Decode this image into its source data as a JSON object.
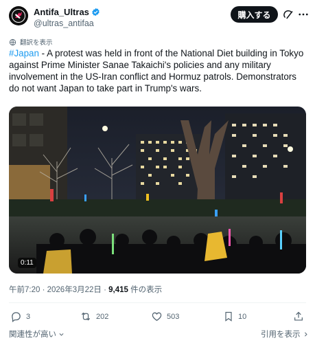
{
  "author": {
    "name": "Antifa_Ultras",
    "handle": "@ultras_antifaa",
    "verified": true
  },
  "header": {
    "buy_label": "購入する"
  },
  "translate": {
    "label": "翻訳を表示"
  },
  "post": {
    "hashtag": "#Japan",
    "text": " - A protest was held in front of the National Diet building in Tokyo against Prime Minister Sanae Takaichi's policies and any military involvement in the US-Iran conflict and Hormuz patrols. Demonstrators do not want Japan to take part in Trump's wars."
  },
  "media": {
    "duration": "0:11"
  },
  "meta": {
    "time": "午前7:20",
    "sep": " · ",
    "date": "2026年3月22日",
    "views": "9,415",
    "views_label": " 件の表示"
  },
  "actions": {
    "replies": "3",
    "reposts": "202",
    "likes": "503",
    "bookmarks": "10"
  },
  "footer": {
    "sort_label": "関連性が高い",
    "quotes_label": "引用を表示"
  },
  "colors": {
    "accent": "#1d9bf0",
    "text": "#0f1419",
    "muted": "#536471"
  }
}
